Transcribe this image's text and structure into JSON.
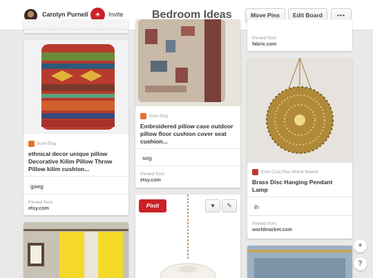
{
  "header": {
    "username": "Carolyn Purnell",
    "invite_label": "Invite",
    "board_title": "Bedroom Ideas",
    "move_pins_label": "Move Pins",
    "edit_board_label": "Edit Board",
    "more_label": "•••"
  },
  "pins": [
    {
      "source": "from Etsy",
      "description": "ethnical decor unique pillow Decorative Kilim Pillow Throw Pillow kilim cushion...",
      "comment": "gaeg",
      "pinned_from_label": "Pinned from",
      "domain": "etsy.com"
    },
    {
      "source": "from Etsy",
      "description": "Embroidered pillow case outdoor pillow floor cushion cover seat cushion...",
      "comment": "seg",
      "pinned_from_label": "Pinned from",
      "domain": "etsy.com"
    },
    {
      "pinned_from_label": "Pinned from",
      "domain": "fabric.com"
    },
    {
      "source": "from Cost Plus World Market",
      "description": "Brass Disc Hanging Pendant Lamp",
      "comment": "ih",
      "pinned_from_label": "Pinned from",
      "domain": "worldmarket.com"
    }
  ],
  "hover_actions": {
    "pinit_label": "Pinit",
    "like_icon": "heart-icon",
    "edit_icon": "pencil-icon"
  },
  "floating": {
    "add_label": "+",
    "help_label": "?"
  }
}
